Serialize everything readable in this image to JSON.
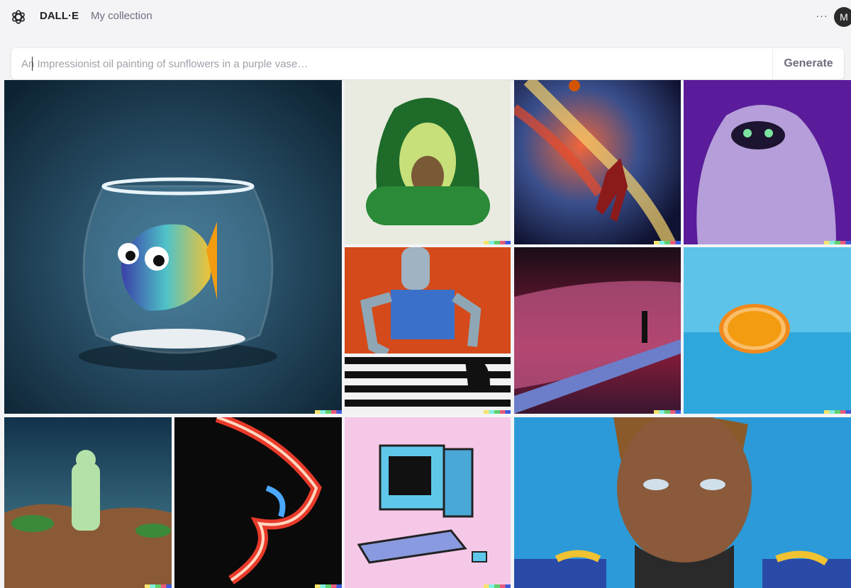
{
  "header": {
    "brand": "DALL·E",
    "nav_link": "My collection",
    "avatar_initial": "M",
    "more_label": "···"
  },
  "prompt": {
    "placeholder": "An Impressionist oil painting of sunflowers in a purple vase…",
    "value": "",
    "button_label": "Generate"
  },
  "gallery": {
    "items": [
      {
        "subject": "fish in bowl"
      },
      {
        "subject": "avocado armchair"
      },
      {
        "subject": "basketball player space painting"
      },
      {
        "subject": "purple monster"
      },
      {
        "subject": "robot playing chess painting"
      },
      {
        "subject": "figure on wave"
      },
      {
        "subject": "orange half"
      },
      {
        "subject": "astronaut in desert"
      },
      {
        "subject": "neon face"
      },
      {
        "subject": "retro computer illustration"
      },
      {
        "subject": "portrait painting"
      }
    ]
  },
  "colors": {
    "accent": "#202123",
    "muted": "#6e6e80",
    "background": "#f4f4f6"
  }
}
